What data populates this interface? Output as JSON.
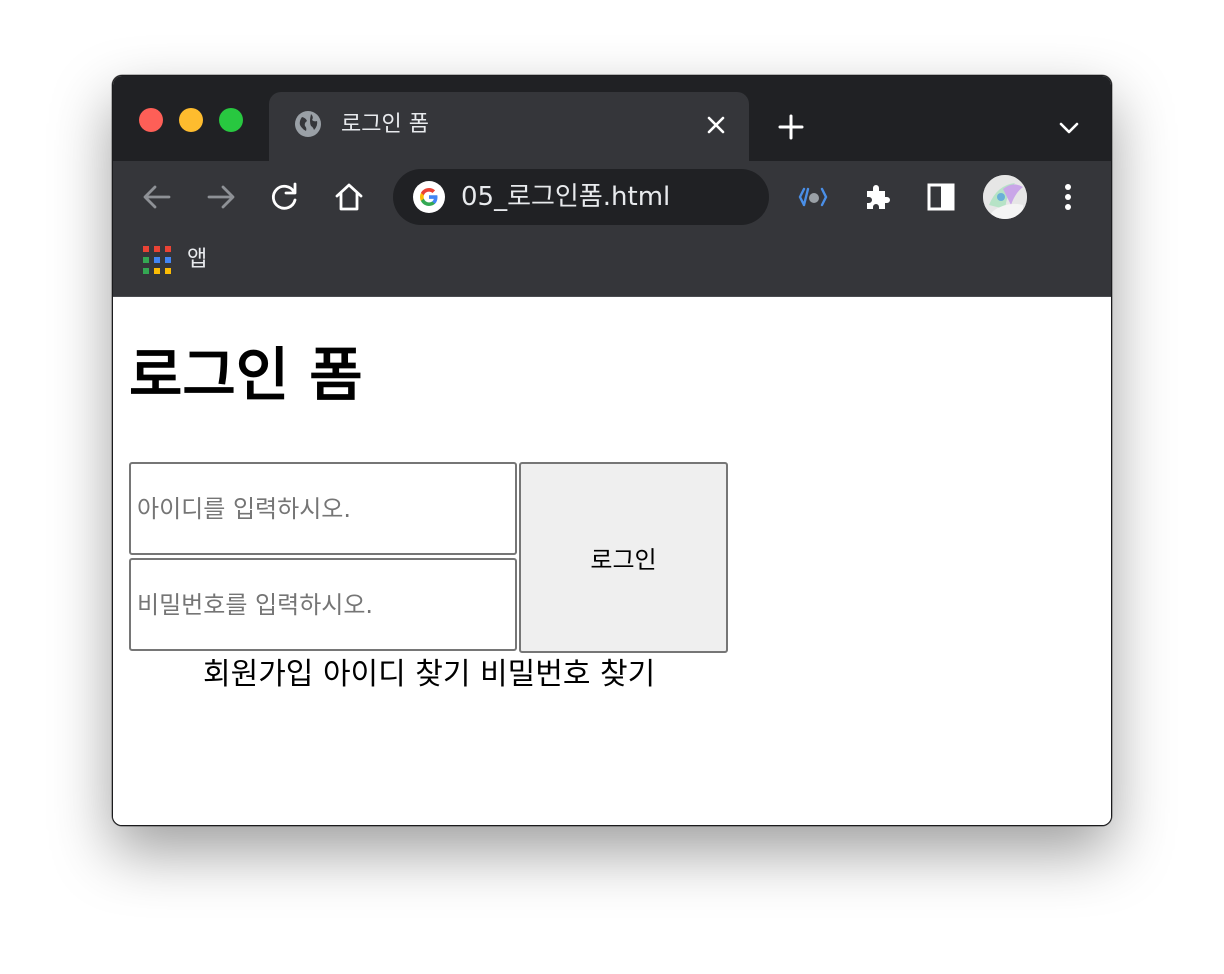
{
  "browser": {
    "tab_title": "로그인 폼",
    "url": "05_로그인폼.html",
    "bookmarks_bar": {
      "apps_label": "앱"
    }
  },
  "page": {
    "heading": "로그인 폼",
    "form": {
      "id_placeholder": "아이디를 입력하시오.",
      "id_value": "",
      "password_placeholder": "비밀번호를 입력하시오.",
      "password_value": "",
      "login_button_label": "로그인"
    },
    "links": [
      "회원가입",
      "아이디 찾기",
      "비밀번호 찾기"
    ]
  },
  "colors": {
    "titlebar": "#202124",
    "toolbar": "#35363a",
    "omnibox": "#202124",
    "button_bg": "#efefef",
    "field_border": "#767676"
  },
  "icons": [
    "globe-icon",
    "close-icon",
    "new-tab-icon",
    "tab-search-icon",
    "back-icon",
    "forward-icon",
    "reload-icon",
    "home-icon",
    "google-icon",
    "devtools-extension-icon",
    "extensions-puzzle-icon",
    "side-panel-icon",
    "profile-avatar",
    "menu-dots-icon",
    "apps-grid-icon"
  ]
}
